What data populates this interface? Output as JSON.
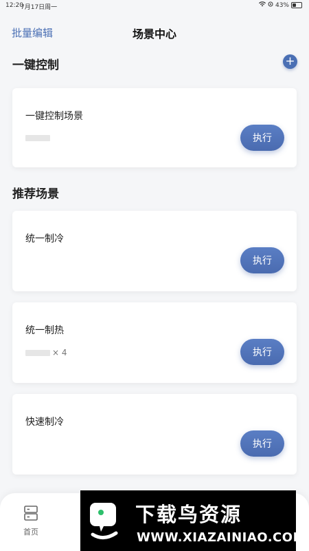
{
  "status_bar": {
    "time": "12:20",
    "date": "7月17日周一",
    "battery": "43%",
    "battery_level": 0.43
  },
  "nav": {
    "left_action": "批量编辑",
    "title": "场景中心"
  },
  "sections": {
    "one_key": {
      "title": "一键控制",
      "add_label": "+"
    },
    "recommended": {
      "title": "推荐场景"
    }
  },
  "one_key_card": {
    "title": "一键控制场景",
    "button": "执行"
  },
  "recommended_cards": [
    {
      "title": "统一制冷",
      "button": "执行"
    },
    {
      "title": "统一制热",
      "count": "× 4",
      "button": "执行"
    },
    {
      "title": "快速制冷",
      "button": "执行"
    }
  ],
  "tabbar": {
    "home_label": "首页"
  },
  "watermark": {
    "brand": "下载鸟资源",
    "url": "WWW.XIAZAINIAO.COM"
  },
  "colors": {
    "accent": "#4a6fb4",
    "background": "#f5f6f8"
  }
}
